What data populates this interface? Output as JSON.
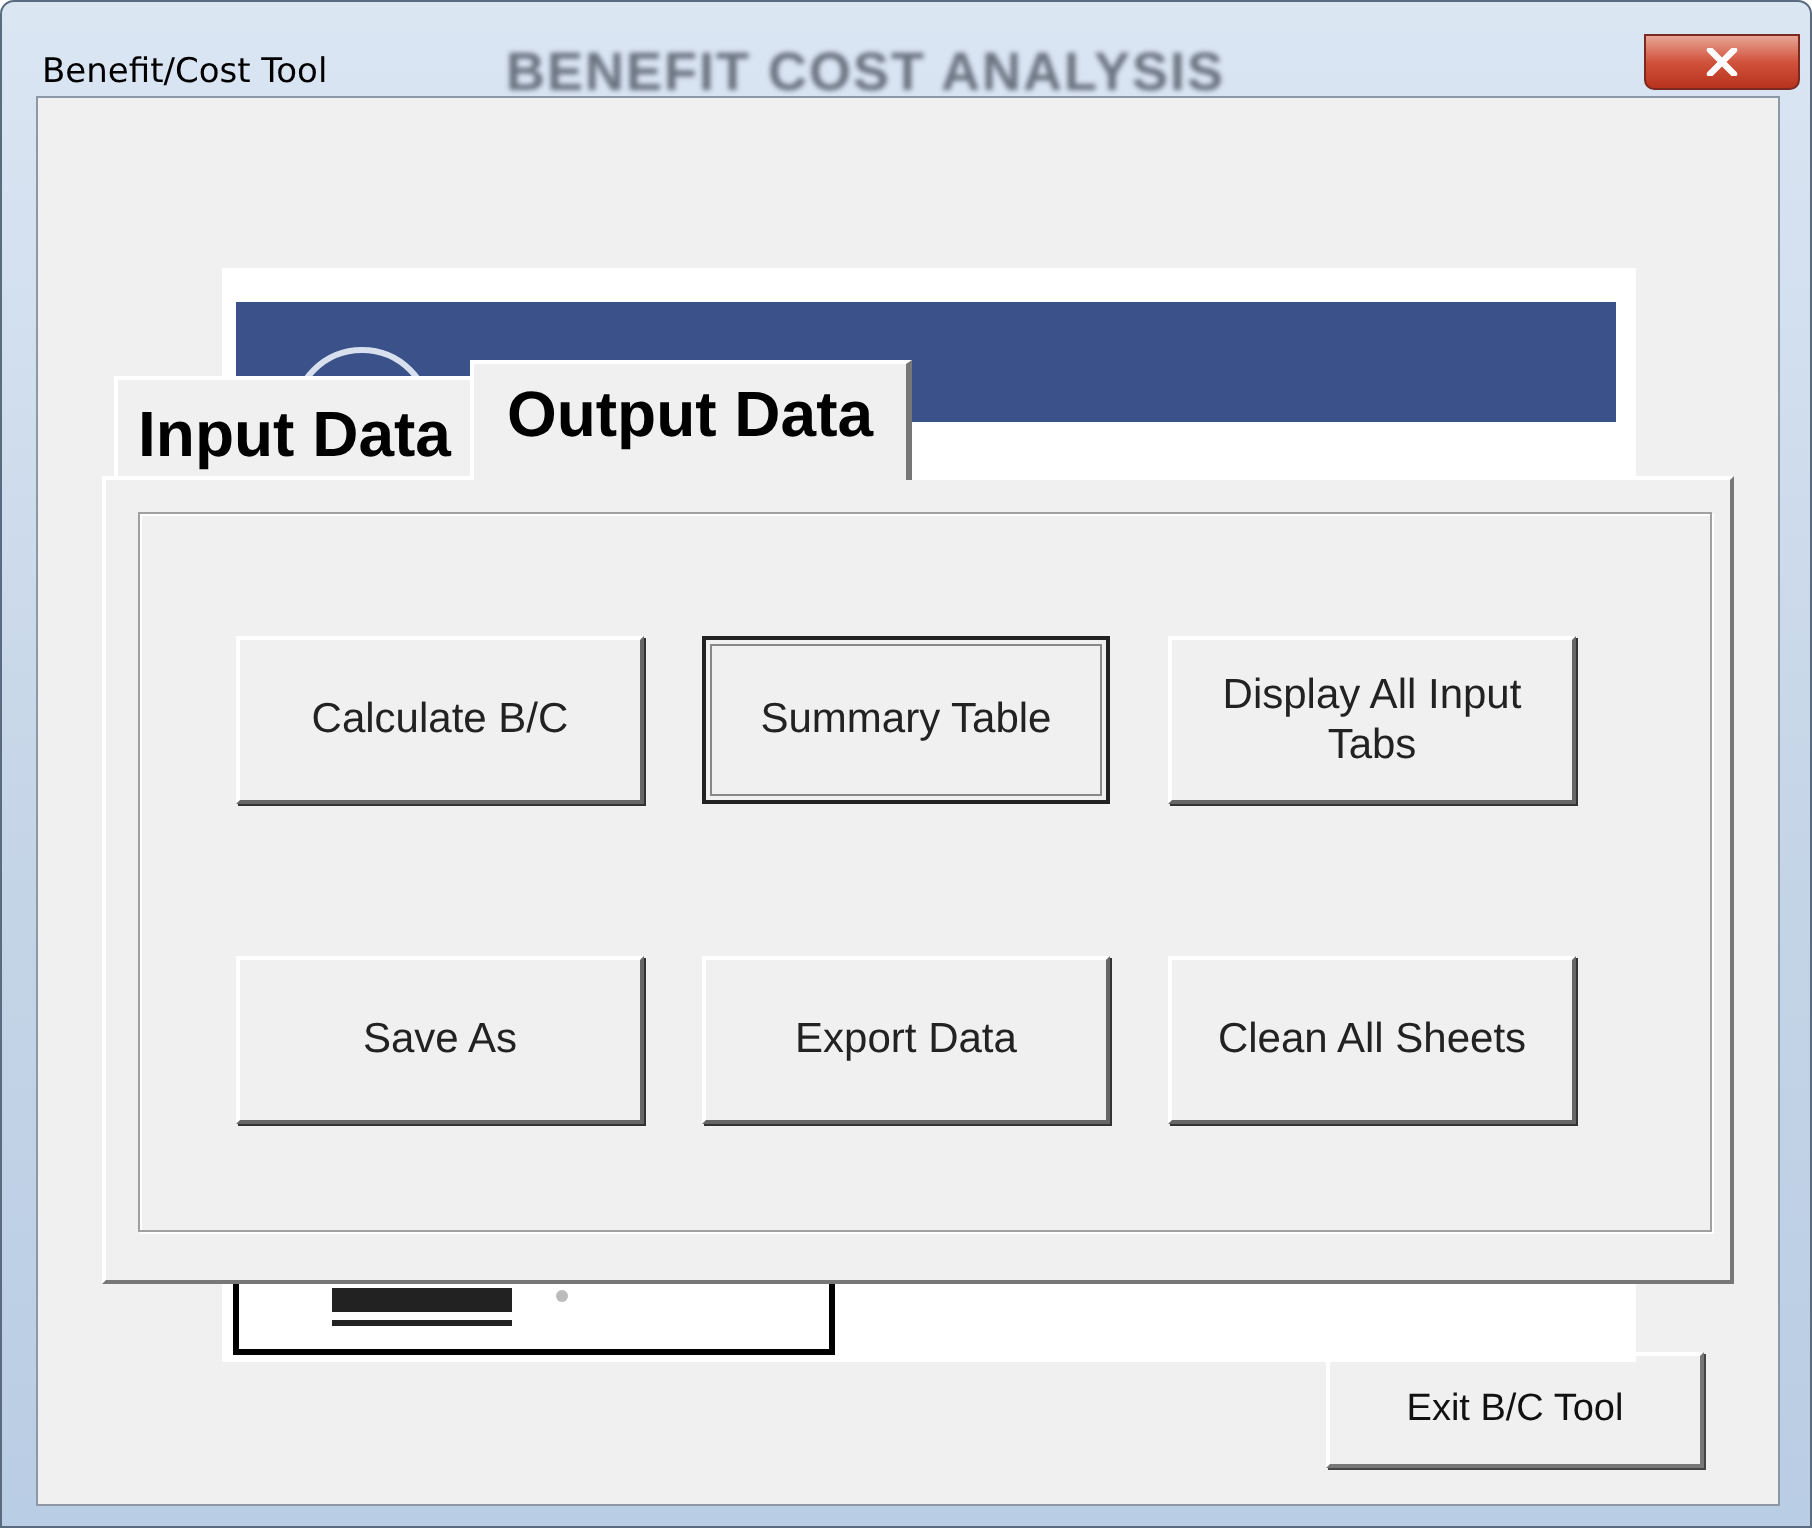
{
  "window": {
    "title": "Benefit/Cost Tool",
    "background_title": "BENEFIT COST ANALYSIS"
  },
  "tabs": [
    {
      "label": "Input Data",
      "selected": false
    },
    {
      "label": "Output Data",
      "selected": true
    }
  ],
  "buttons": [
    {
      "label": "Calculate B/C",
      "focused": false
    },
    {
      "label": "Summary Table",
      "focused": true
    },
    {
      "label": "Display All Input Tabs",
      "focused": false
    },
    {
      "label": "Save As",
      "focused": false
    },
    {
      "label": "Export Data",
      "focused": false
    },
    {
      "label": "Clean All Sheets",
      "focused": false
    }
  ],
  "exit_button": {
    "label": "Exit B/C Tool"
  }
}
